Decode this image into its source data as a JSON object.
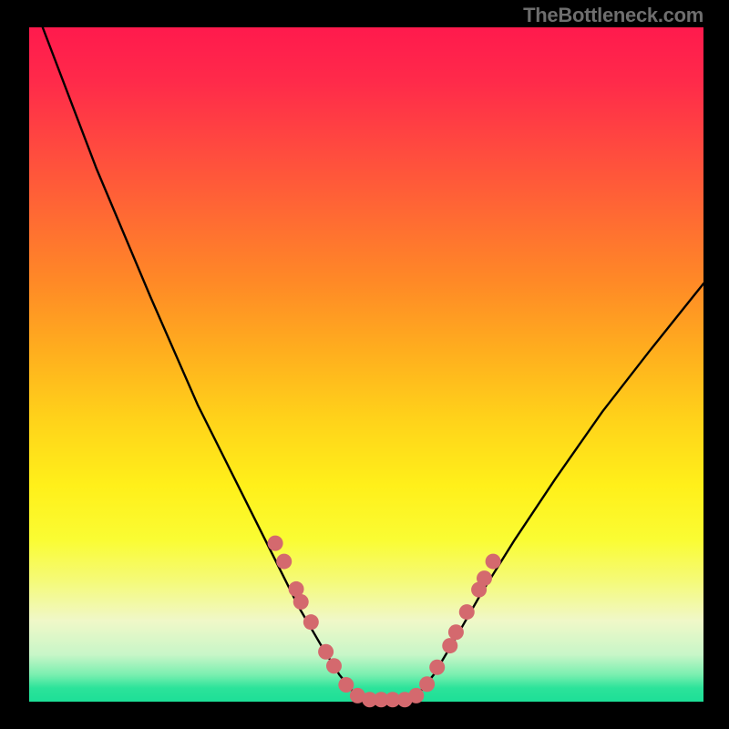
{
  "attribution": "TheBottleneck.com",
  "chart_data": {
    "type": "line",
    "title": "",
    "xlabel": "",
    "ylabel": "",
    "xlim": [
      0,
      100
    ],
    "ylim": [
      0,
      100
    ],
    "series": [
      {
        "name": "left-curve",
        "x": [
          2,
          10,
          18,
          25,
          31,
          36,
          40,
          43.5,
          46,
          48,
          49.5
        ],
        "y": [
          100,
          79,
          60,
          44,
          32,
          22,
          14,
          8,
          4,
          1.5,
          0.3
        ]
      },
      {
        "name": "flat-bottom",
        "x": [
          49.5,
          56.5
        ],
        "y": [
          0.3,
          0.3
        ]
      },
      {
        "name": "right-curve",
        "x": [
          56.5,
          58,
          60,
          63,
          67,
          72,
          78,
          85,
          92,
          100
        ],
        "y": [
          0.3,
          1.5,
          4,
          9,
          16,
          24,
          33,
          43,
          52,
          62
        ]
      }
    ],
    "markers": [
      {
        "x": 36.5,
        "y": 23.5
      },
      {
        "x": 37.8,
        "y": 20.8
      },
      {
        "x": 39.6,
        "y": 16.7
      },
      {
        "x": 40.3,
        "y": 14.8
      },
      {
        "x": 41.8,
        "y": 11.8
      },
      {
        "x": 44.0,
        "y": 7.4
      },
      {
        "x": 45.2,
        "y": 5.3
      },
      {
        "x": 47.0,
        "y": 2.5
      },
      {
        "x": 48.7,
        "y": 0.9
      },
      {
        "x": 50.5,
        "y": 0.3
      },
      {
        "x": 52.2,
        "y": 0.3
      },
      {
        "x": 53.9,
        "y": 0.3
      },
      {
        "x": 55.7,
        "y": 0.3
      },
      {
        "x": 57.4,
        "y": 0.9
      },
      {
        "x": 59.0,
        "y": 2.6
      },
      {
        "x": 60.5,
        "y": 5.1
      },
      {
        "x": 62.4,
        "y": 8.3
      },
      {
        "x": 63.3,
        "y": 10.3
      },
      {
        "x": 64.9,
        "y": 13.3
      },
      {
        "x": 66.7,
        "y": 16.6
      },
      {
        "x": 67.5,
        "y": 18.3
      },
      {
        "x": 68.8,
        "y": 20.8
      }
    ],
    "colors": {
      "gradient_top": "#ff1a4d",
      "gradient_bottom": "#1ddf97",
      "curve": "#000000",
      "marker": "#d4696e",
      "frame": "#000000"
    }
  }
}
